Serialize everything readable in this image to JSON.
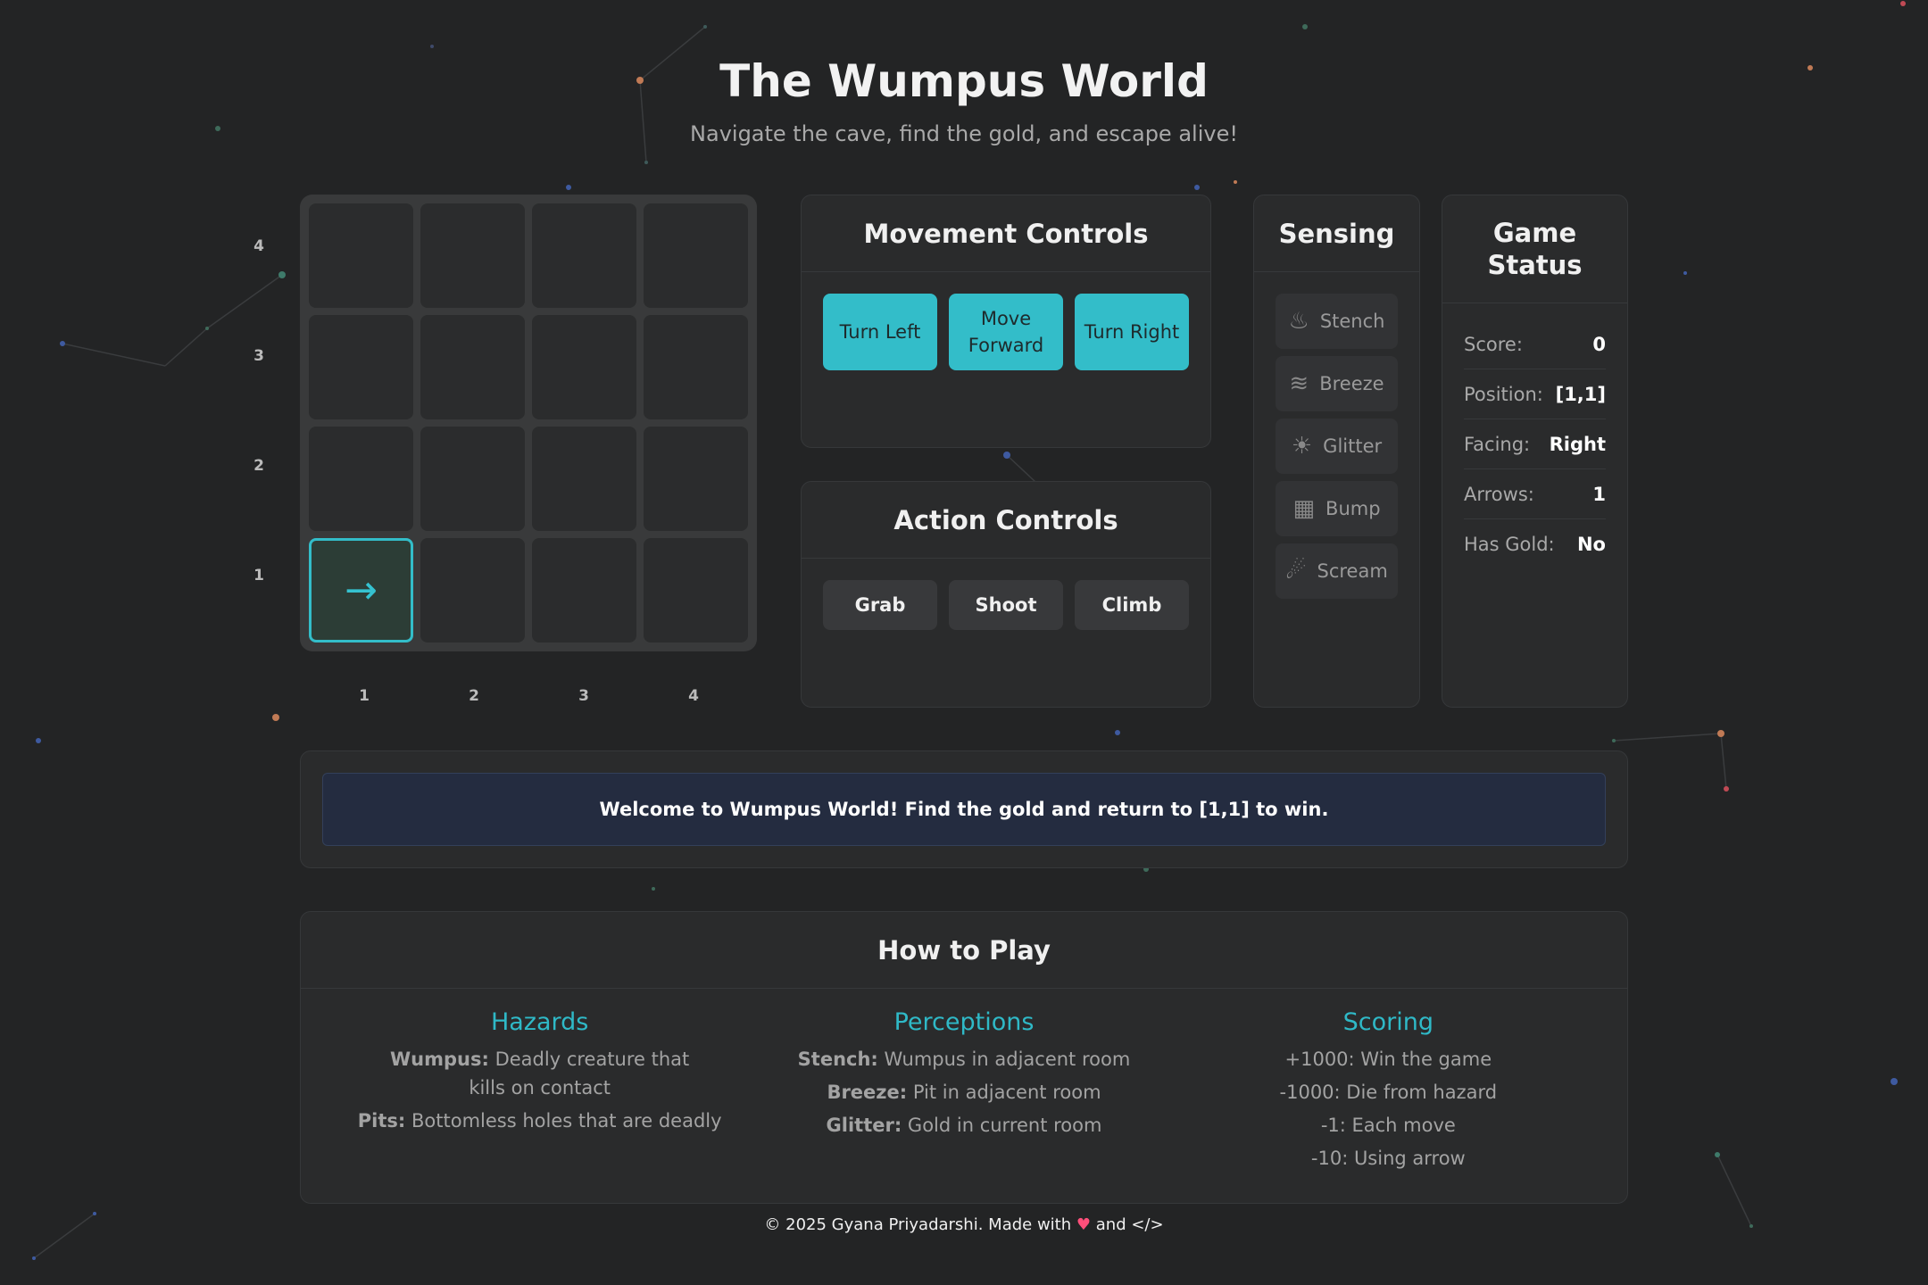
{
  "header": {
    "title": "The Wumpus World",
    "subtitle": "Navigate the cave, find the gold, and escape alive!"
  },
  "grid": {
    "row_labels": [
      "4",
      "3",
      "2",
      "1"
    ],
    "col_labels": [
      "1",
      "2",
      "3",
      "4"
    ],
    "agent_glyph": "→",
    "agent_cell": "[1,1]"
  },
  "movement": {
    "title": "Movement Controls",
    "turn_left": "Turn Left",
    "move_forward": "Move Forward",
    "turn_right": "Turn Right"
  },
  "action": {
    "title": "Action Controls",
    "grab": "Grab",
    "shoot": "Shoot",
    "climb": "Climb"
  },
  "sensing": {
    "title": "Sensing",
    "items": [
      {
        "label": "Stench",
        "icon": "stench-icon"
      },
      {
        "label": "Breeze",
        "icon": "wind-icon"
      },
      {
        "label": "Glitter",
        "icon": "sparkle-icon"
      },
      {
        "label": "Bump",
        "icon": "wall-icon"
      },
      {
        "label": "Scream",
        "icon": "scream-icon"
      }
    ]
  },
  "status": {
    "title": "Game Status",
    "rows": [
      {
        "label": "Score:",
        "value": "0"
      },
      {
        "label": "Position:",
        "value": "[1,1]"
      },
      {
        "label": "Facing:",
        "value": "Right"
      },
      {
        "label": "Arrows:",
        "value": "1"
      },
      {
        "label": "Has Gold:",
        "value": "No"
      }
    ]
  },
  "message": "Welcome to Wumpus World! Find the gold and return to [1,1] to win.",
  "how_to_play": {
    "title": "How to Play",
    "hazards": {
      "title": "Hazards",
      "items": [
        {
          "term": "Wumpus:",
          "text": "Deadly creature that kills on contact"
        },
        {
          "term": "Pits:",
          "text": "Bottomless holes that are deadly"
        }
      ]
    },
    "perceptions": {
      "title": "Perceptions",
      "items": [
        {
          "term": "Stench:",
          "text": "Wumpus in adjacent room"
        },
        {
          "term": "Breeze:",
          "text": "Pit in adjacent room"
        },
        {
          "term": "Glitter:",
          "text": "Gold in current room"
        }
      ]
    },
    "scoring": {
      "title": "Scoring",
      "items": [
        "+1000: Win the game",
        "-1000: Die from hazard",
        "-1: Each move",
        "-10: Using arrow"
      ]
    }
  },
  "footer": {
    "prefix": "© 2025 Gyana Priyadarshi. Made with",
    "heart": "♥",
    "suffix": "and </>"
  },
  "colors": {
    "accent": "#33bdc9",
    "background": "#232425",
    "panel": "#2a2b2c",
    "message_bg": "#242c40"
  }
}
